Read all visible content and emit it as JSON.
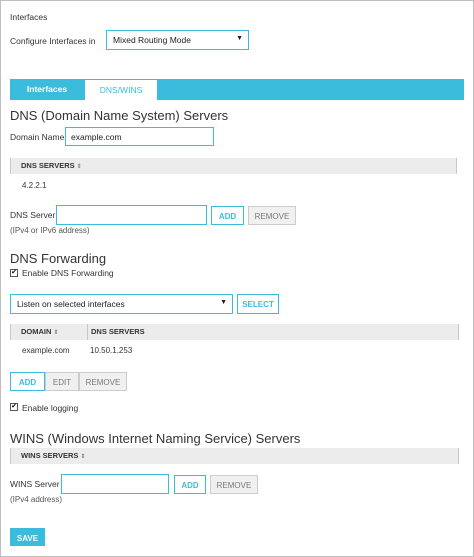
{
  "breadcrumb": "Interfaces",
  "configure": {
    "label": "Configure Interfaces in",
    "value": "Mixed Routing Mode"
  },
  "tabs": [
    {
      "label": "Interfaces"
    },
    {
      "label": "DNS/WINS"
    }
  ],
  "dns": {
    "heading": "DNS (Domain Name System) Servers",
    "domain_label": "Domain Name",
    "domain_value": "example.com",
    "table_header": "DNS SERVERS",
    "servers": [
      "4.2.2.1"
    ],
    "server_label": "DNS Server",
    "server_value": "",
    "add_label": "ADD",
    "remove_label": "REMOVE",
    "hint": "(IPv4 or IPv6 address)"
  },
  "forwarding": {
    "heading": "DNS Forwarding",
    "enable_label": "Enable DNS Forwarding",
    "enable_checked": true,
    "listen_value": "Listen on selected interfaces",
    "select_label": "SELECT",
    "columns": [
      "DOMAIN",
      "DNS SERVERS"
    ],
    "rows": [
      {
        "domain": "example.com",
        "server": "10.50.1.253"
      }
    ],
    "add_label": "ADD",
    "edit_label": "EDIT",
    "remove_label": "REMOVE",
    "logging_label": "Enable logging",
    "logging_checked": true
  },
  "wins": {
    "heading": "WINS (Windows Internet Naming Service) Servers",
    "table_header": "WINS SERVERS",
    "server_label": "WINS Server",
    "server_value": "",
    "add_label": "ADD",
    "remove_label": "REMOVE",
    "hint": "(IPv4 address)"
  },
  "save_label": "SAVE",
  "icons": {
    "sort": "sort-arrows-icon",
    "dropdown": "chevron-down-icon",
    "check": "checkmark-icon"
  },
  "colors": {
    "accent": "#3bbcdc",
    "header_bg": "#ececec"
  }
}
